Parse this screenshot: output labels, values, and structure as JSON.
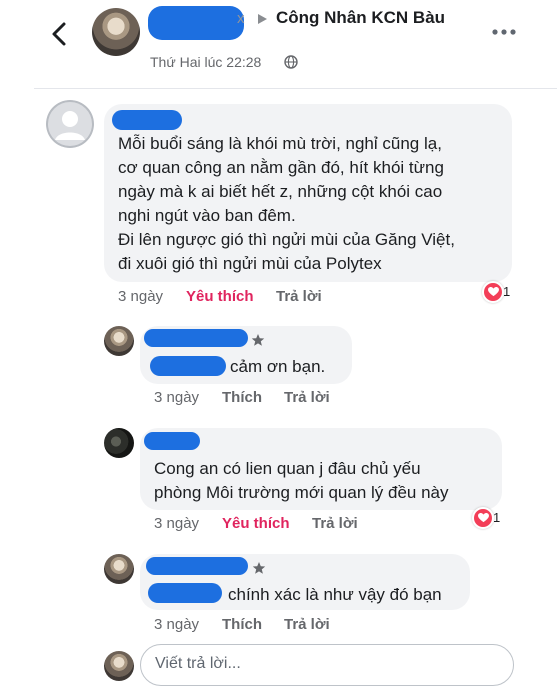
{
  "header": {
    "group_name": "Công Nhân KCN Bàu",
    "timestamp": "Thứ Hai lúc 22:28",
    "back_icon": "chevron-left-icon",
    "more_icon": "more-horizontal-icon",
    "privacy_icon": "globe-icon"
  },
  "comments": [
    {
      "text_lines": [
        "Mỗi buổi sáng là khói mù trời, nghỉ cũng lạ,",
        "cơ quan công an nằm gần đó, hít khói từng",
        "ngày mà k ai biết hết z, những cột khói cao",
        "nghi ngút vào ban đêm.",
        "Đi lên ngược gió thì ngửi mùi của Găng Việt,",
        "đi xuôi gió thì ngửi mùi của Polytex"
      ],
      "time": "3 ngày",
      "like": "Yêu thích",
      "reply": "Trả lời",
      "reaction_count": "1"
    }
  ],
  "replies": [
    {
      "text": "cảm ơn bạn.",
      "time": "3 ngày",
      "like": "Thích",
      "reply": "Trả lời"
    },
    {
      "text_lines": [
        "Cong an có lien quan j đâu chủ yếu",
        "phòng Môi trường mới quan lý đều này"
      ],
      "time": "3 ngày",
      "like": "Yêu thích",
      "reply": "Trả lời",
      "reaction_count": "1"
    },
    {
      "text": "chính xác là như vậy đó bạn",
      "time": "3 ngày",
      "like": "Thích",
      "reply": "Trả lời"
    }
  ],
  "composer": {
    "placeholder": "Viết trả lời..."
  },
  "colors": {
    "liked": "#e0245e",
    "bubble": "#f2f3f5",
    "meta": "#65676b",
    "heart": "#f33e58"
  }
}
